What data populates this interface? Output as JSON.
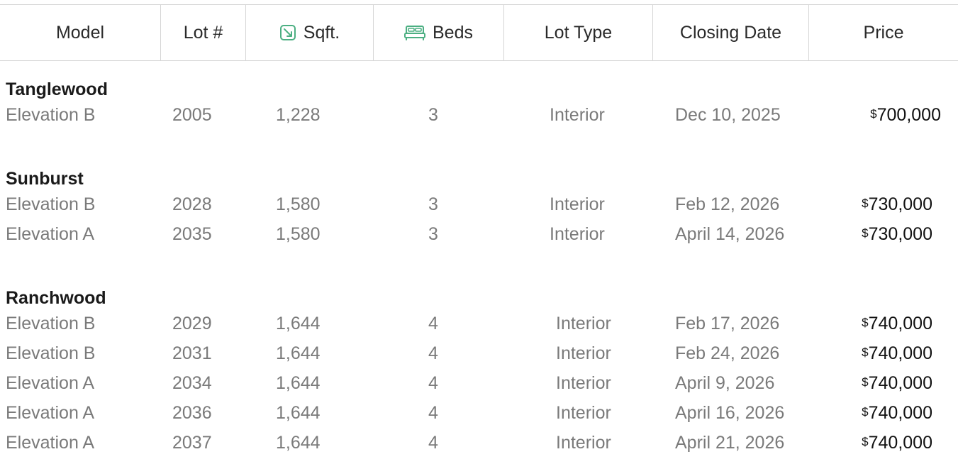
{
  "table": {
    "headers": {
      "model": "Model",
      "lot": "Lot #",
      "sqft": "Sqft.",
      "beds": "Beds",
      "lot_type": "Lot Type",
      "closing_date": "Closing Date",
      "price": "Price"
    },
    "icon_color": "#4caf82",
    "groups": [
      {
        "name": "Tanglewood",
        "rows": [
          {
            "elevation": "Elevation B",
            "lot": "2005",
            "sqft": "1,228",
            "beds": "3",
            "lot_type": "Interior",
            "closing": "Dec 10, 2025",
            "currency": "$",
            "price": "700,000"
          }
        ]
      },
      {
        "name": "Sunburst",
        "rows": [
          {
            "elevation": "Elevation B",
            "lot": "2028",
            "sqft": "1,580",
            "beds": "3",
            "lot_type": "Interior",
            "closing": "Feb 12, 2026",
            "currency": "$",
            "price": "730,000"
          },
          {
            "elevation": "Elevation A",
            "lot": "2035",
            "sqft": "1,580",
            "beds": "3",
            "lot_type": "Interior",
            "closing": "April 14, 2026",
            "currency": "$",
            "price": "730,000"
          }
        ]
      },
      {
        "name": "Ranchwood",
        "rows": [
          {
            "elevation": "Elevation B",
            "lot": "2029",
            "sqft": "1,644",
            "beds": "4",
            "lot_type": "Interior",
            "closing": "Feb 17, 2026",
            "currency": "$",
            "price": "740,000"
          },
          {
            "elevation": "Elevation B",
            "lot": "2031",
            "sqft": "1,644",
            "beds": "4",
            "lot_type": "Interior",
            "closing": "Feb 24, 2026",
            "currency": "$",
            "price": "740,000"
          },
          {
            "elevation": "Elevation A",
            "lot": "2034",
            "sqft": "1,644",
            "beds": "4",
            "lot_type": "Interior",
            "closing": "April 9, 2026",
            "currency": "$",
            "price": "740,000"
          },
          {
            "elevation": "Elevation A",
            "lot": "2036",
            "sqft": "1,644",
            "beds": "4",
            "lot_type": "Interior",
            "closing": "April 16, 2026",
            "currency": "$",
            "price": "740,000"
          },
          {
            "elevation": "Elevation A",
            "lot": "2037",
            "sqft": "1,644",
            "beds": "4",
            "lot_type": "Interior",
            "closing": "April 21, 2026",
            "currency": "$",
            "price": "740,000"
          }
        ]
      }
    ]
  }
}
